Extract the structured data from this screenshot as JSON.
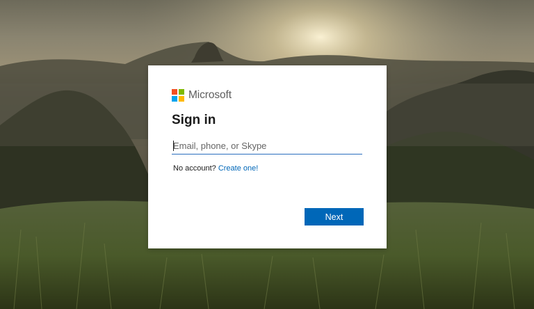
{
  "brand": {
    "name": "Microsoft",
    "logo_colors": [
      "#f25022",
      "#7fba00",
      "#00a4ef",
      "#ffb900"
    ]
  },
  "signin": {
    "title": "Sign in",
    "email": {
      "value": "",
      "placeholder": "Email, phone, or Skype"
    },
    "no_account_text": "No account? ",
    "create_link": "Create one!",
    "next_label": "Next"
  },
  "colors": {
    "accent": "#0067b8",
    "input_underline": "#2a6ebe"
  }
}
